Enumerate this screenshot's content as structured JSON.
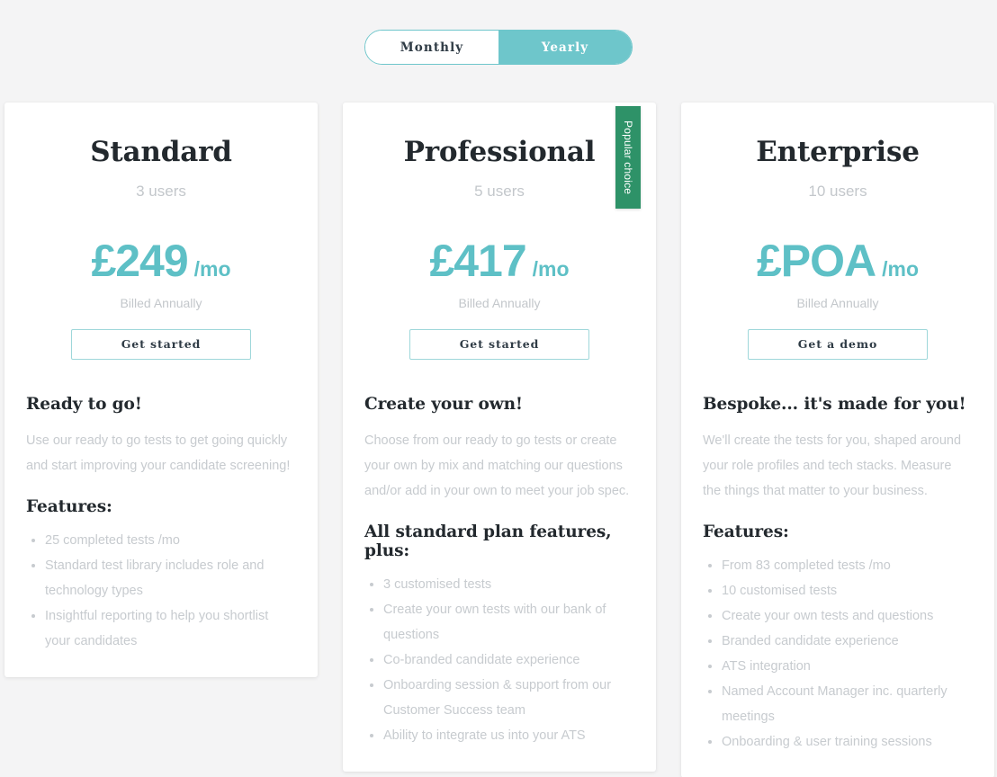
{
  "billing_toggle": {
    "monthly_label": "Monthly",
    "yearly_label": "Yearly",
    "selected": "Yearly",
    "active_color": "#6ec6cb",
    "border_color": "#6ec6cb"
  },
  "theme": {
    "page_background": "#f4f4f5",
    "card_background": "#ffffff",
    "accent_teal": "#5ec0c6",
    "heading_color": "#23292e",
    "muted_text": "#c7cbcf",
    "ribbon_green": "#2e9268"
  },
  "plans": [
    {
      "name": "Standard",
      "users": "3 users",
      "price": "£249",
      "price_period": "/mo",
      "billed": "Billed Annually",
      "cta_label": "Get started",
      "body_title": "Ready to go!",
      "body_desc": "Use our ready to go tests to get going quickly and start improving your candidate screening!",
      "features_title": "Features:",
      "features": [
        "25 completed tests /mo",
        "Standard test library includes role and technology types",
        "Insightful reporting to help you shortlist your candidates"
      ],
      "ribbon": null
    },
    {
      "name": "Professional",
      "users": "5 users",
      "price": "£417",
      "price_period": "/mo",
      "billed": "Billed Annually",
      "cta_label": "Get started",
      "body_title": "Create your own!",
      "body_desc": "Choose from our ready to go tests or create your own by mix and matching our questions and/or add in your own to meet your job spec.",
      "features_title": "All standard plan features, plus:",
      "features": [
        "3 customised tests",
        "Create your own tests with our bank of questions",
        "Co-branded candidate experience",
        "Onboarding session & support from our Customer Success team",
        "Ability to integrate us into your ATS"
      ],
      "ribbon": "Popular choice"
    },
    {
      "name": "Enterprise",
      "users": "10 users",
      "price": "£POA",
      "price_period": "/mo",
      "billed": "Billed Annually",
      "cta_label": "Get a demo",
      "body_title": "Bespoke... it's made for you!",
      "body_desc": "We'll create the tests for you, shaped around your role profiles and tech stacks. Measure the things that matter to your business.",
      "features_title": "Features:",
      "features": [
        "From 83 completed tests /mo",
        "10 customised tests",
        "Create your own tests and questions",
        "Branded candidate experience",
        "ATS integration",
        "Named Account Manager inc. quarterly meetings",
        "Onboarding & user training sessions"
      ],
      "ribbon": null
    }
  ]
}
